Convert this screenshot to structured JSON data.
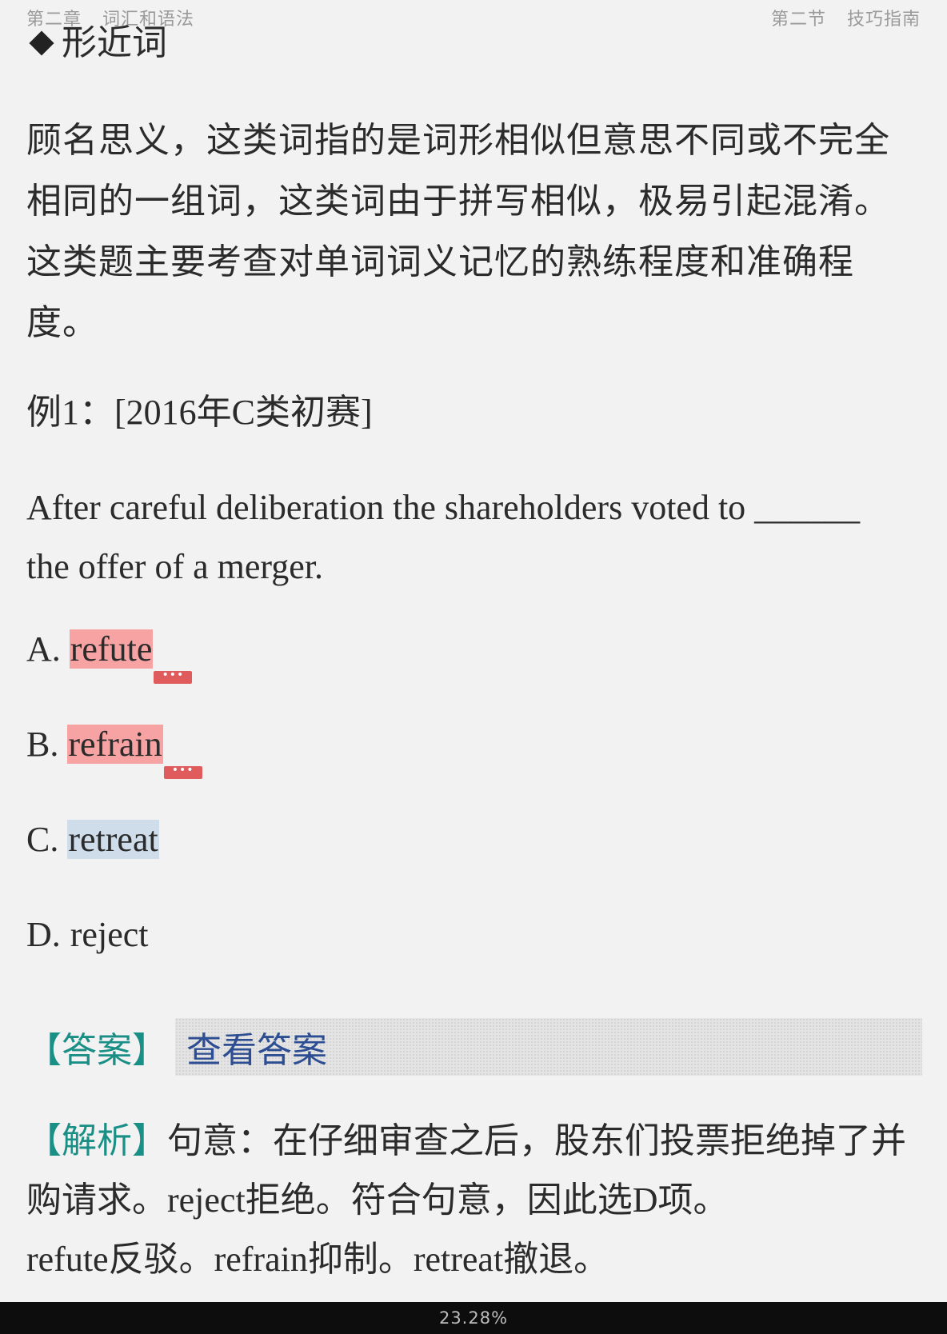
{
  "header": {
    "chapter": "第二章",
    "chapter_title": "词汇和语法",
    "section": "第二节",
    "section_title": "技巧指南"
  },
  "content": {
    "section_heading": "形近词",
    "intro": "顾名思义，这类词指的是词形相似但意思不同或不完全相同的一组词，这类词由于拼写相似，极易引起混淆。这类题主要考查对单词词义记忆的熟练程度和准确程度。",
    "example_label": "例1：[2016年C类初赛]",
    "question_line1": "After careful deliberation the shareholders voted to ______",
    "question_line2": "the offer of a merger.",
    "options": [
      {
        "letter": "A.",
        "word": "refute",
        "highlight": "#f7a3a3",
        "note": "•••"
      },
      {
        "letter": "B.",
        "word": "refrain",
        "highlight": "#f7a3a3",
        "note": "•••"
      },
      {
        "letter": "C.",
        "word": "retreat",
        "highlight": "#cfdce9"
      },
      {
        "letter": "D.",
        "word": "reject"
      }
    ],
    "answer_label": "【答案】",
    "answer_link": "查看答案",
    "analysis_label": "【解析】",
    "analysis_p1": "句意：在仔细审查之后，股东们投票拒绝掉了并购请求。",
    "analysis_w1": "reject",
    "analysis_p2": "拒绝。符合句意，因此选",
    "analysis_w2": "D",
    "analysis_p3": "项。",
    "analysis_w3": "refute",
    "analysis_p4": "反驳。",
    "analysis_w4": "refrain",
    "analysis_p5": "抑制。",
    "analysis_w5": "retreat",
    "analysis_p6": "撤退。"
  },
  "footer": {
    "progress": "23.28%"
  },
  "colors": {
    "label_teal": "#1a8f86",
    "link_blue": "#2d4e93",
    "highlight_red": "#f7a3a3",
    "highlight_blue": "#cfdce9",
    "note_red": "#e05c5c"
  }
}
